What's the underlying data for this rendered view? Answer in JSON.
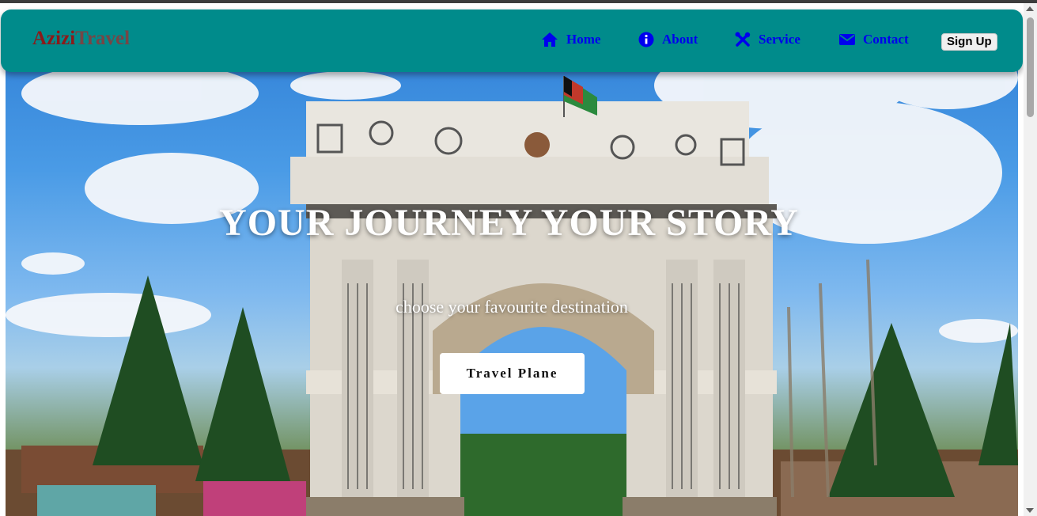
{
  "brand": {
    "part1": "Azizi",
    "part2": "Travel"
  },
  "nav": {
    "items": [
      {
        "label": "Home",
        "icon": "home-icon"
      },
      {
        "label": "About",
        "icon": "info-icon"
      },
      {
        "label": "Service",
        "icon": "tools-icon"
      },
      {
        "label": "Contact",
        "icon": "envelope-icon"
      }
    ],
    "signup_label": "Sign Up"
  },
  "hero": {
    "headline": "YOUR JOURNEY YOUR STORY",
    "subline": "choose your favourite destination",
    "cta_label": "Travel Plane"
  },
  "colors": {
    "navbar_bg": "#008b8b",
    "nav_link": "#0000ee",
    "brand_part1": "#8b1a1a",
    "brand_part2": "#8b3a3a"
  }
}
